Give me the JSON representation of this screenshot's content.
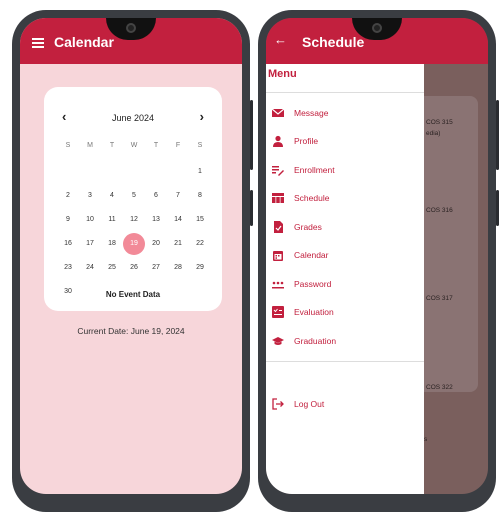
{
  "left_screen": {
    "title": "Calendar",
    "calendar": {
      "month_label": "June 2024",
      "prev": "‹",
      "next": "›",
      "weekdays": [
        "S",
        "M",
        "T",
        "W",
        "T",
        "F",
        "S"
      ],
      "weeks": [
        [
          "",
          "",
          "",
          "",
          "",
          "",
          "1"
        ],
        [
          "2",
          "3",
          "4",
          "5",
          "6",
          "7",
          "8"
        ],
        [
          "9",
          "10",
          "11",
          "12",
          "13",
          "14",
          "15"
        ],
        [
          "16",
          "17",
          "18",
          "19",
          "20",
          "21",
          "22"
        ],
        [
          "23",
          "24",
          "25",
          "26",
          "27",
          "28",
          "29"
        ],
        [
          "30",
          "",
          "",
          "",
          "",
          "",
          ""
        ]
      ],
      "selected_day": "19",
      "no_event_text": "No Event Data"
    },
    "current_date": "Current Date: June 19, 2024"
  },
  "right_screen": {
    "title": "Schedule",
    "background_fragments": [
      "COS 315",
      "edia)",
      "COS 316",
      "COS 317",
      "COS 322",
      "s"
    ],
    "drawer": {
      "title": "Menu",
      "items": [
        {
          "label": "Message",
          "icon": "mail-icon"
        },
        {
          "label": "Profile",
          "icon": "person-icon"
        },
        {
          "label": "Enrollment",
          "icon": "edit-list-icon"
        },
        {
          "label": "Schedule",
          "icon": "table-icon"
        },
        {
          "label": "Grades",
          "icon": "document-icon"
        },
        {
          "label": "Calendar",
          "icon": "calendar-icon"
        },
        {
          "label": "Password",
          "icon": "password-icon"
        },
        {
          "label": "Evaluation",
          "icon": "evaluation-icon"
        },
        {
          "label": "Graduation",
          "icon": "graduation-cap-icon"
        }
      ],
      "logout": {
        "label": "Log Out",
        "icon": "logout-icon"
      }
    }
  },
  "colors": {
    "primary": "#c2203e",
    "calendar_bg": "#f7d6da",
    "selected_day": "#f28a98"
  }
}
